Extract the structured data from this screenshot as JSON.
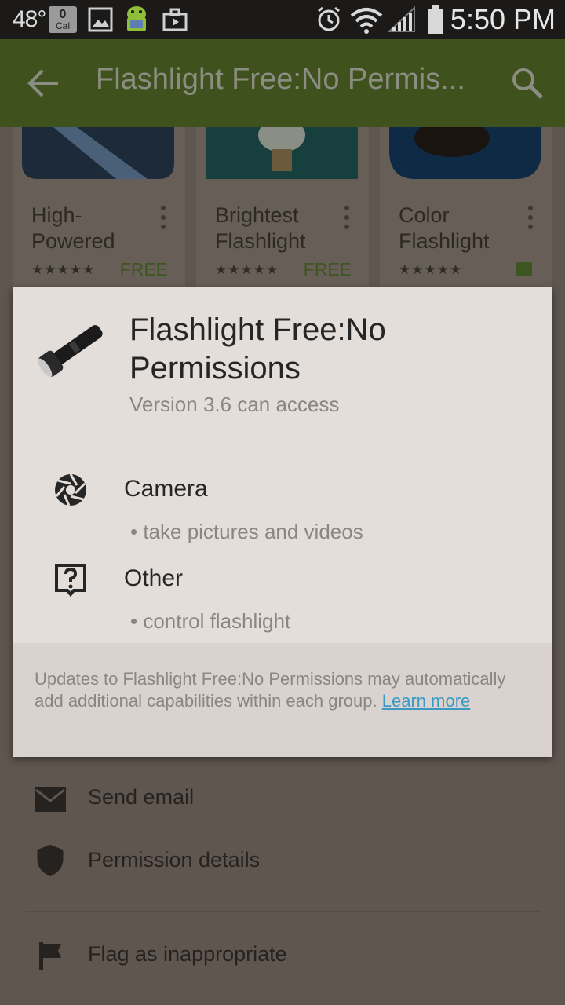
{
  "status_bar": {
    "temperature": "48°",
    "calendar_number": "0",
    "calendar_label": "Cal",
    "time": "5:50 PM",
    "icons": [
      "calendar-icon",
      "gallery-icon",
      "android-icon",
      "briefcase-icon",
      "alarm-icon",
      "wifi-icon",
      "signal-icon",
      "battery-icon"
    ]
  },
  "toolbar": {
    "title": "Flashlight Free:No Permis...",
    "back_icon": "arrow-back-icon",
    "search_icon": "search-icon",
    "color": "#3f521e"
  },
  "cards": [
    {
      "title": "High-Powered",
      "stars": "★★★★★",
      "price": "FREE"
    },
    {
      "title": "Brightest Flashlight",
      "stars": "★★★★★",
      "price": "FREE"
    },
    {
      "title": "Color Flashlight",
      "stars": "★★★★★",
      "price": ""
    }
  ],
  "dialog": {
    "title": "Flashlight Free:No Permissions",
    "version": "Version 3.6 can access",
    "permissions": [
      {
        "name": "Camera",
        "detail": "• take pictures and videos",
        "icon": "camera-aperture-icon"
      },
      {
        "name": "Other",
        "detail": "• control flashlight",
        "icon": "question-box-icon"
      }
    ],
    "footer_text": "Updates to Flashlight Free:No Permissions may automatically add additional capabilities within each group.",
    "learn_more": "Learn more",
    "link_color": "#3b9ac4"
  },
  "list": [
    {
      "label": "Send email",
      "icon": "email-icon"
    },
    {
      "label": "Permission details",
      "icon": "shield-icon"
    },
    {
      "label": "Flag as inappropriate",
      "icon": "flag-icon"
    }
  ]
}
